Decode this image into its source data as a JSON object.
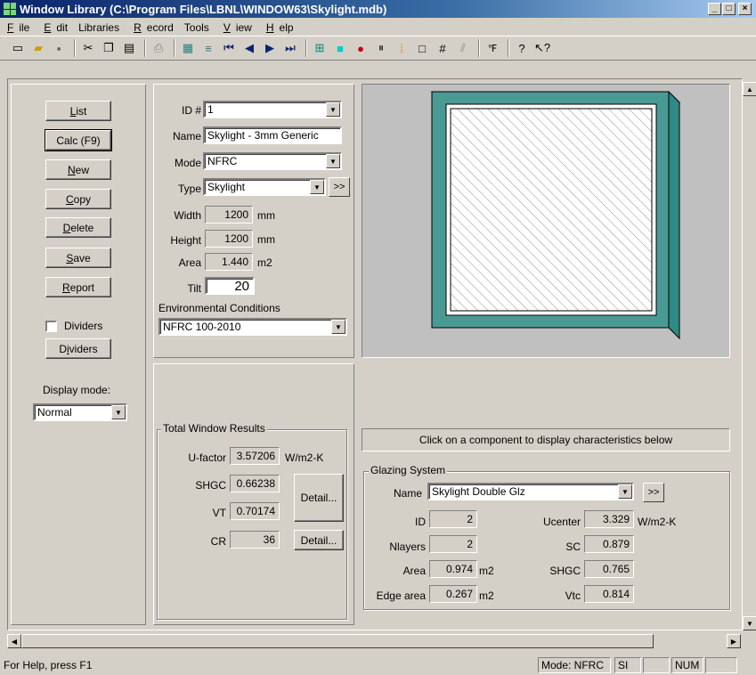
{
  "window": {
    "title": "Window Library (C:\\Program Files\\LBNL\\WINDOW63\\Skylight.mdb)",
    "min": "_",
    "max": "□",
    "close": "×"
  },
  "menu": {
    "file": "File",
    "edit": "Edit",
    "libraries": "Libraries",
    "record": "Record",
    "tools": "Tools",
    "view": "View",
    "help": "Help"
  },
  "sidebar": {
    "list": "List",
    "calc": "Calc (F9)",
    "new": "New",
    "copy": "Copy",
    "delete": "Delete",
    "save": "Save",
    "report": "Report",
    "dividers_check": "Dividers",
    "dividers_btn": "Dividers",
    "display_mode_label": "Display mode:",
    "display_mode_value": "Normal"
  },
  "record": {
    "id_label": "ID #",
    "id_value": "1",
    "name_label": "Name",
    "name_value": "Skylight - 3mm Generic",
    "mode_label": "Mode",
    "mode_value": "NFRC",
    "type_label": "Type",
    "type_value": "Skylight",
    "type_more": ">>",
    "width_label": "Width",
    "width_value": "1200",
    "width_unit": "mm",
    "height_label": "Height",
    "height_value": "1200",
    "height_unit": "mm",
    "area_label": "Area",
    "area_value": "1.440",
    "area_unit": "m2",
    "tilt_label": "Tilt",
    "tilt_value": "20",
    "env_label": "Environmental Conditions",
    "env_value": "NFRC 100-2010"
  },
  "results": {
    "title": "Total Window Results",
    "ufactor_label": "U-factor",
    "ufactor_value": "3.57206",
    "ufactor_unit": "W/m2-K",
    "shgc_label": "SHGC",
    "shgc_value": "0.66238",
    "vt_label": "VT",
    "vt_value": "0.70174",
    "cr_label": "CR",
    "cr_value": "36",
    "detail1": "Detail...",
    "detail2": "Detail..."
  },
  "component": {
    "hint": "Click on a component to display characteristics below"
  },
  "glazing": {
    "title": "Glazing System",
    "name_label": "Name",
    "name_value": "Skylight Double Glz",
    "more": ">>",
    "id_label": "ID",
    "id_value": "2",
    "nlayers_label": "Nlayers",
    "nlayers_value": "2",
    "area_label": "Area",
    "area_value": "0.974",
    "area_unit": "m2",
    "edge_label": "Edge area",
    "edge_value": "0.267",
    "edge_unit": "m2",
    "ucenter_label": "Ucenter",
    "ucenter_value": "3.329",
    "ucenter_unit": "W/m2-K",
    "sc_label": "SC",
    "sc_value": "0.879",
    "shgc_label": "SHGC",
    "shgc_value": "0.765",
    "vtc_label": "Vtc",
    "vtc_value": "0.814"
  },
  "status": {
    "help": "For Help, press F1",
    "mode": "Mode: NFRC",
    "units": "SI",
    "num": "NUM"
  },
  "colors": {
    "frame": "#4a9a94",
    "titlebar": "#0a246a"
  }
}
